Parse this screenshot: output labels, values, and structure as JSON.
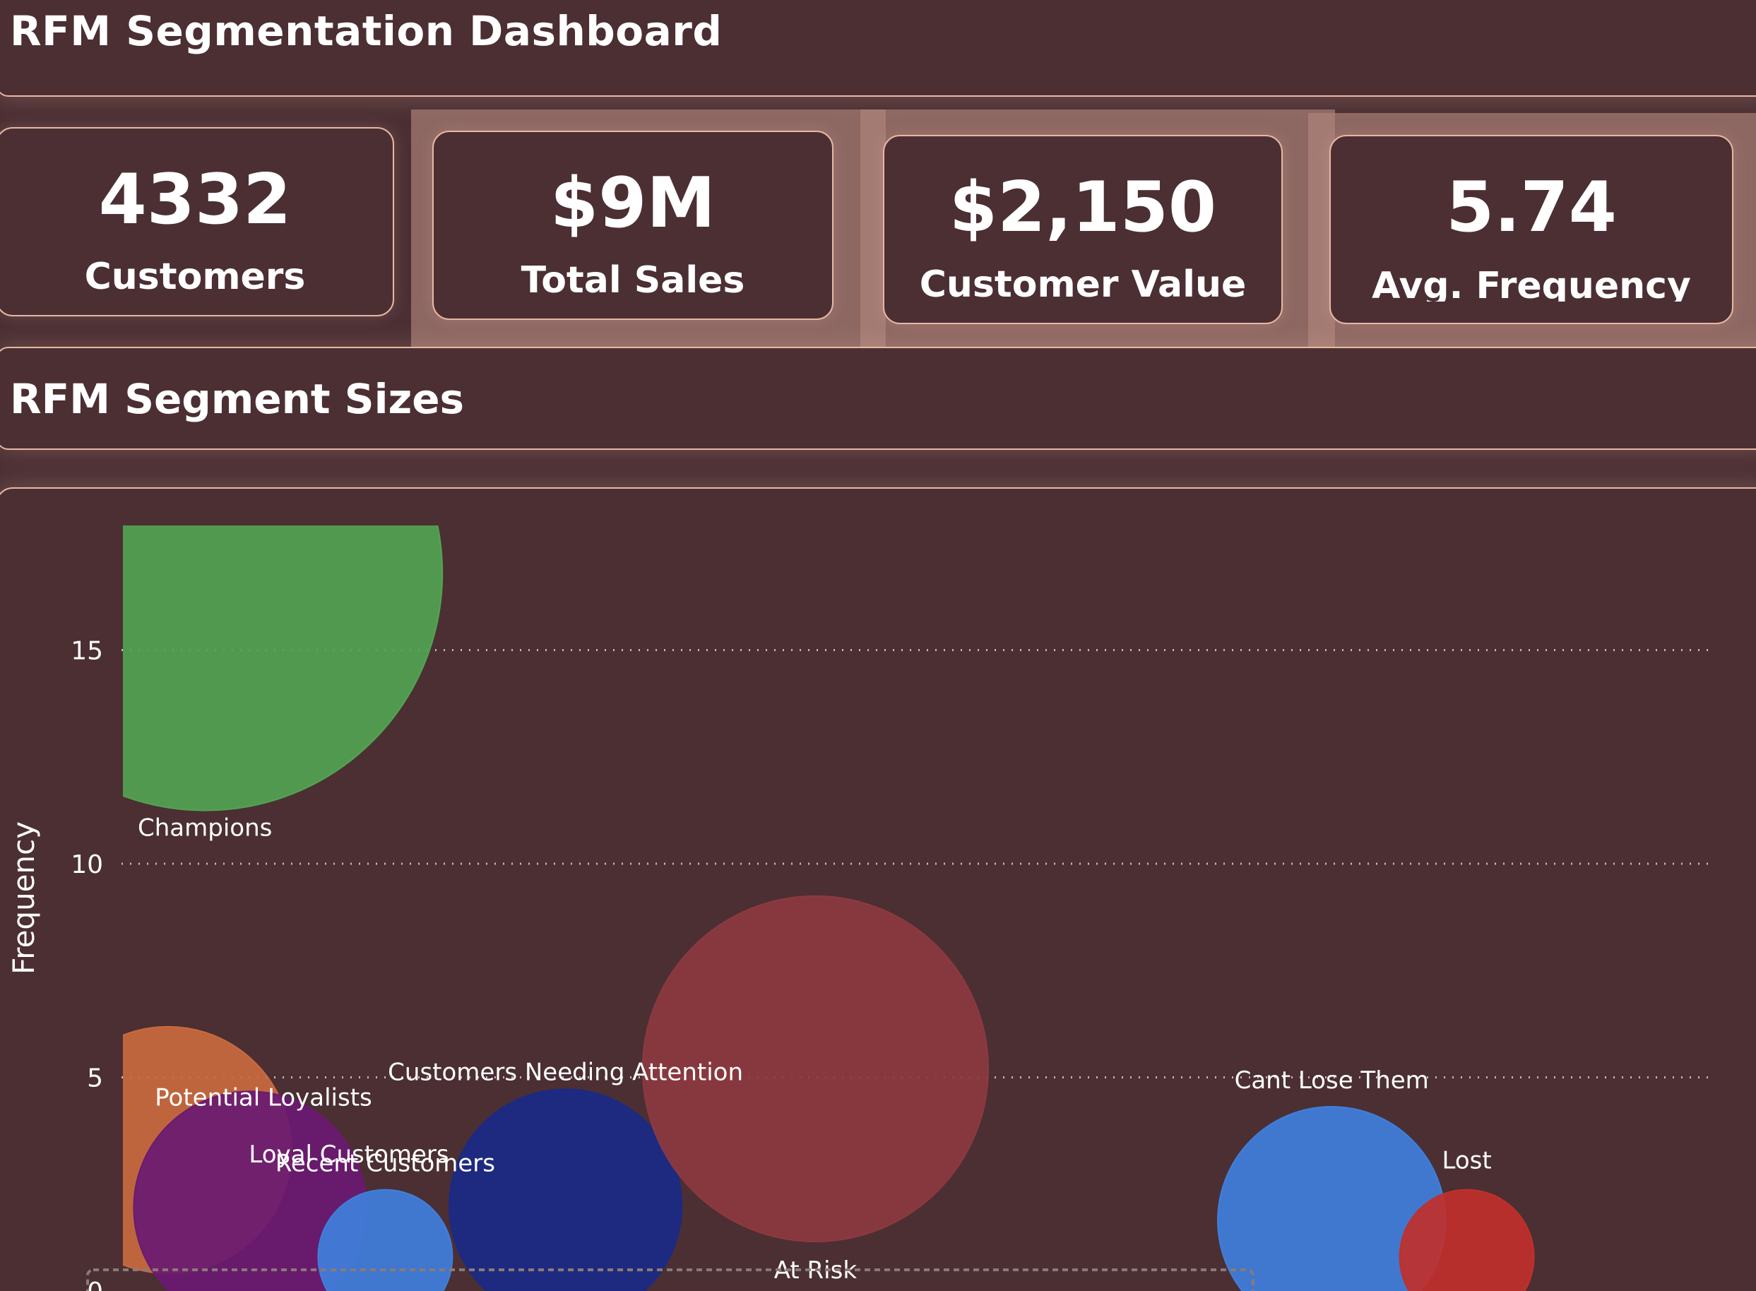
{
  "header": {
    "title": "RFM Segmentation Dashboard"
  },
  "kpis": [
    {
      "value": "4332",
      "label": "Customers"
    },
    {
      "value": "$9M",
      "label": "Total Sales"
    },
    {
      "value": "$2,150",
      "label": "Customer Value"
    },
    {
      "value": "5.74",
      "label": "Avg. Frequency"
    }
  ],
  "section": {
    "title": "RFM Segment Sizes"
  },
  "colors": {
    "background": "#4b2f33",
    "border": "#e7b8a4",
    "gridline": "#c9b8b4"
  },
  "chart_data": {
    "type": "scatter",
    "ylabel": "Frequency",
    "xlabel": "",
    "ylim": [
      0,
      18
    ],
    "yticks": [
      0,
      5,
      10,
      15
    ],
    "grid": true,
    "series": [
      {
        "label": "Champions",
        "x": 1.9,
        "y": 16.8,
        "size": 100,
        "color": "#52a352"
      },
      {
        "label": "Potential Loyalists",
        "x": 1.0,
        "y": 3.3,
        "size": 27,
        "color": "#c96a3f"
      },
      {
        "label": "Loyal Customers",
        "x": 3.0,
        "y": 1.95,
        "size": 24,
        "color": "#6a1a72"
      },
      {
        "label": "Recent Customers",
        "x": 6.3,
        "y": 0.8,
        "size": 8,
        "color": "#3f7fdc"
      },
      {
        "label": "Customers Needing Attention",
        "x": 10.7,
        "y": 2.0,
        "size": 24,
        "color": "#1a2a85"
      },
      {
        "label": "At Risk",
        "x": 16.8,
        "y": 5.2,
        "size": 53,
        "color": "#8c3a3f"
      },
      {
        "label": "Cant Lose Them",
        "x": 29.4,
        "y": 1.65,
        "size": 23,
        "color": "#3f7fdc"
      },
      {
        "label": "Lost",
        "x": 32.7,
        "y": 0.8,
        "size": 8,
        "color": "#c0302d"
      }
    ]
  }
}
